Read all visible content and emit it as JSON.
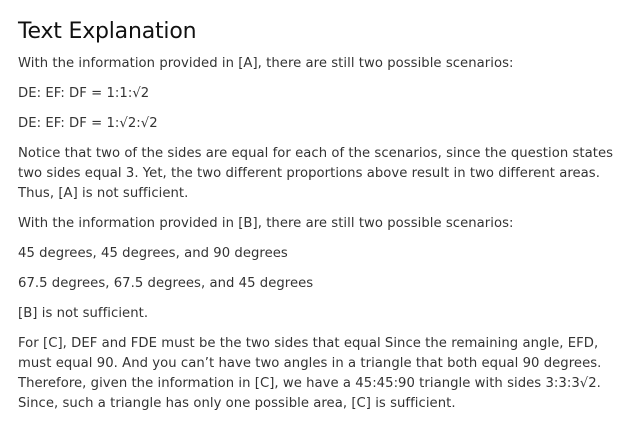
{
  "title": "Text Explanation",
  "paragraphs": [
    "With the information provided in [A], there are still two possible scenarios:",
    "DE: EF: DF = 1:1:√2",
    "DE: EF: DF = 1:√2:√2",
    "Notice that two of the sides are equal for each of the scenarios, since the question states two sides equal 3. Yet, the two different proportions above result in two different areas. Thus, [A] is not sufficient.",
    "With the information provided in [B], there are still two possible scenarios:",
    "45 degrees, 45 degrees, and 90 degrees",
    "67.5 degrees, 67.5 degrees, and 45 degrees",
    "[B] is not sufficient.",
    "For [C], DEF and FDE must be the two sides that equal Since the remaining angle, EFD, must equal 90. And you can’t have two angles in a triangle that both equal 90 degrees. Therefore, given the information in [C], we have a 45:45:90 triangle with sides 3:3:3√2. Since, such a triangle has only one possible area, [C] is sufficient."
  ]
}
